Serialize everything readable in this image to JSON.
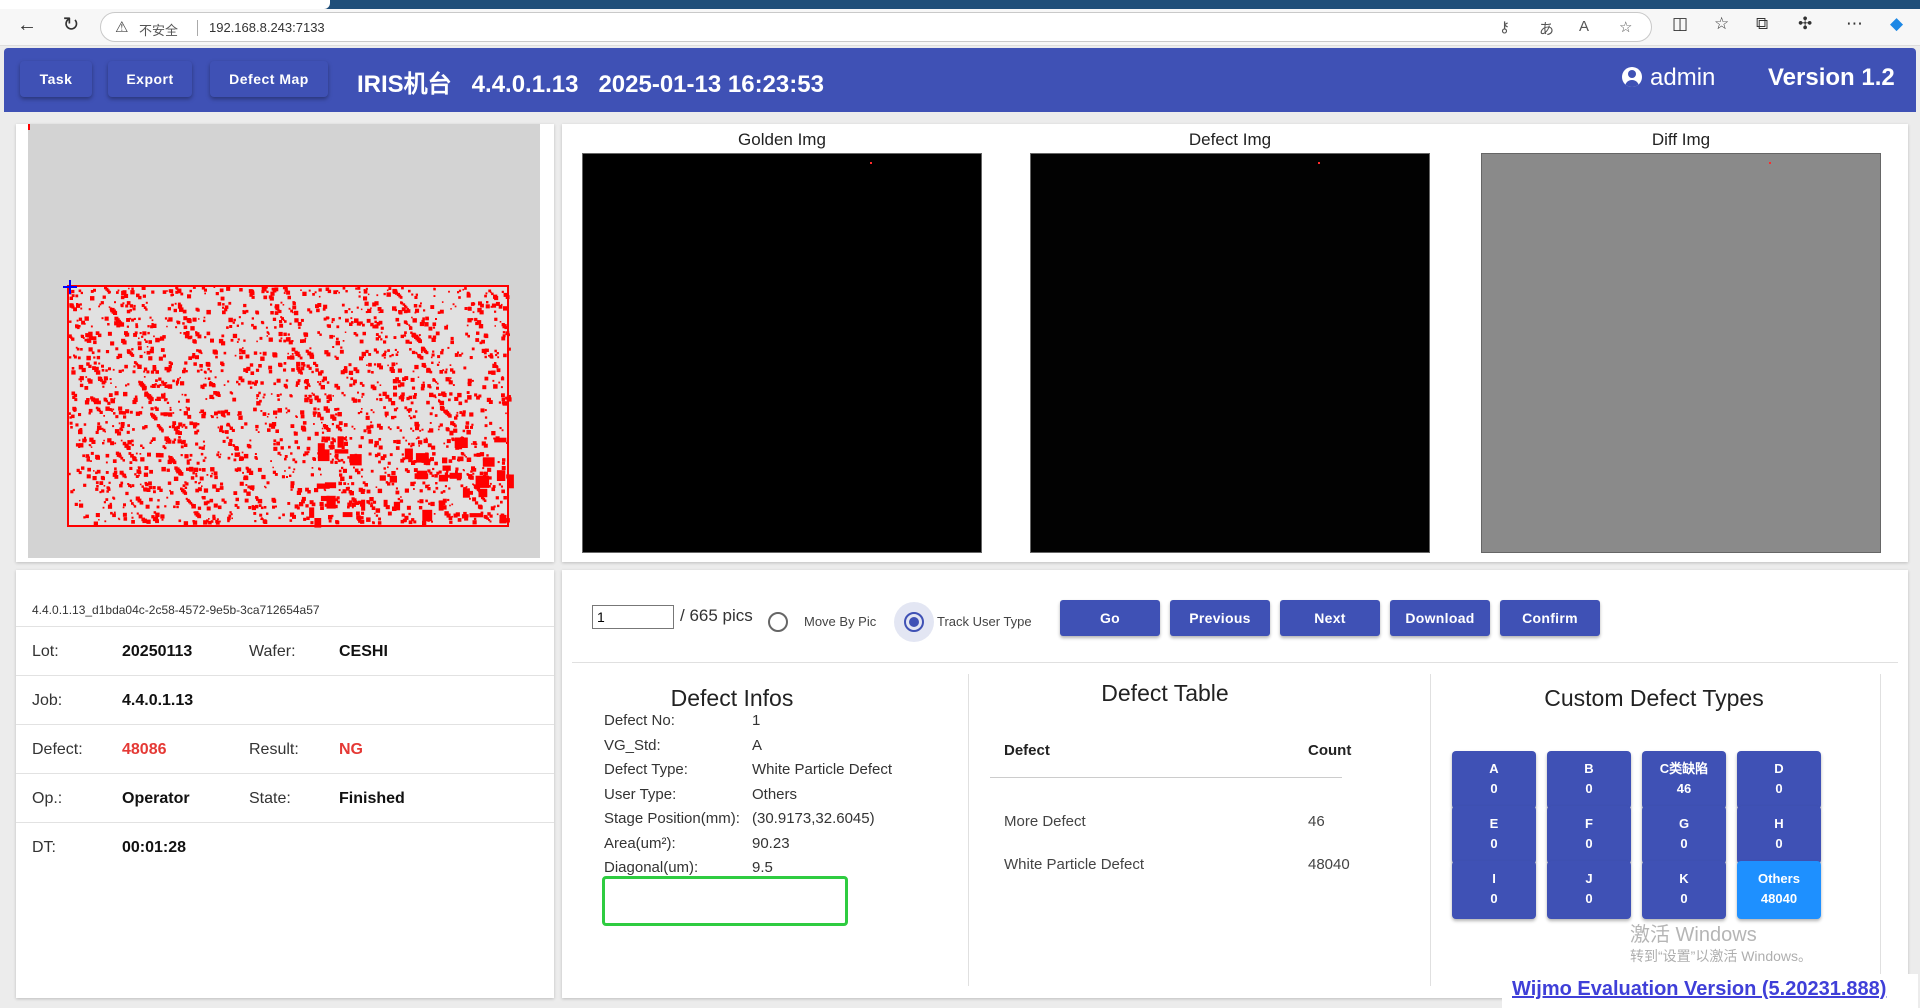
{
  "browser": {
    "insecure_label": "不安全",
    "url": "192.168.8.243:7133"
  },
  "toolbar": {
    "task": "Task",
    "export": "Export",
    "defect_map": "Defect Map"
  },
  "header": {
    "title": "IRIS机台   4.4.0.1.13   2025-01-13 16:23:53",
    "user": "admin",
    "version": "Version 1.2"
  },
  "images": {
    "golden": "Golden Img",
    "defect": "Defect Img",
    "diff": "Diff Img"
  },
  "info": {
    "guid": "4.4.0.1.13_d1bda04c-2c58-4572-9e5b-3ca712654a57",
    "lot_label": "Lot:",
    "lot": "20250113",
    "wafer_label": "Wafer:",
    "wafer": "CESHI",
    "job_label": "Job:",
    "job": "4.4.0.1.13",
    "defect_label": "Defect:",
    "defect": "48086",
    "result_label": "Result:",
    "result": "NG",
    "op_label": "Op.:",
    "op": "Operator",
    "state_label": "State:",
    "state": "Finished",
    "dt_label": "DT:",
    "dt": "00:01:28"
  },
  "controls": {
    "pic_value": "1",
    "total": "/ 665 pics",
    "move_by_pic": "Move By Pic",
    "track_user_type": "Track User Type",
    "go": "Go",
    "previous": "Previous",
    "next": "Next",
    "download": "Download",
    "confirm": "Confirm"
  },
  "defect_infos": {
    "title": "Defect Infos",
    "rows": [
      {
        "k": "Defect No:",
        "v": "1"
      },
      {
        "k": "VG_Std:",
        "v": "A"
      },
      {
        "k": "Defect Type:",
        "v": "White Particle Defect"
      },
      {
        "k": "User Type:",
        "v": "Others"
      },
      {
        "k": "Stage Position(mm):",
        "v": "(30.9173,32.6045)"
      },
      {
        "k": "Area(um²):",
        "v": "90.23"
      },
      {
        "k": "Diagonal(um):",
        "v": "9.5"
      }
    ]
  },
  "defect_table": {
    "title": "Defect Table",
    "col_defect": "Defect",
    "col_count": "Count",
    "rows": [
      {
        "defect": "More Defect",
        "count": "46"
      },
      {
        "defect": "White Particle Defect",
        "count": "48040"
      }
    ]
  },
  "custom_types": {
    "title": "Custom Defect Types",
    "items": [
      {
        "name": "A",
        "count": "0"
      },
      {
        "name": "B",
        "count": "0"
      },
      {
        "name": "C类缺陷",
        "count": "46"
      },
      {
        "name": "D",
        "count": "0"
      },
      {
        "name": "E",
        "count": "0"
      },
      {
        "name": "F",
        "count": "0"
      },
      {
        "name": "G",
        "count": "0"
      },
      {
        "name": "H",
        "count": "0"
      },
      {
        "name": "I",
        "count": "0"
      },
      {
        "name": "J",
        "count": "0"
      },
      {
        "name": "K",
        "count": "0"
      },
      {
        "name": "Others",
        "count": "48040"
      }
    ]
  },
  "overlays": {
    "activate": "激活 Windows",
    "activate_hint": "转到“设置”以激活 Windows。",
    "wijmo": "Wijmo Evaluation Version (5.20231.888)"
  },
  "colors": {
    "primary": "#3f51b5",
    "defect_red": "#ff0000",
    "active_type": "#1e90ff",
    "highlight_box": "#2ecc40"
  }
}
